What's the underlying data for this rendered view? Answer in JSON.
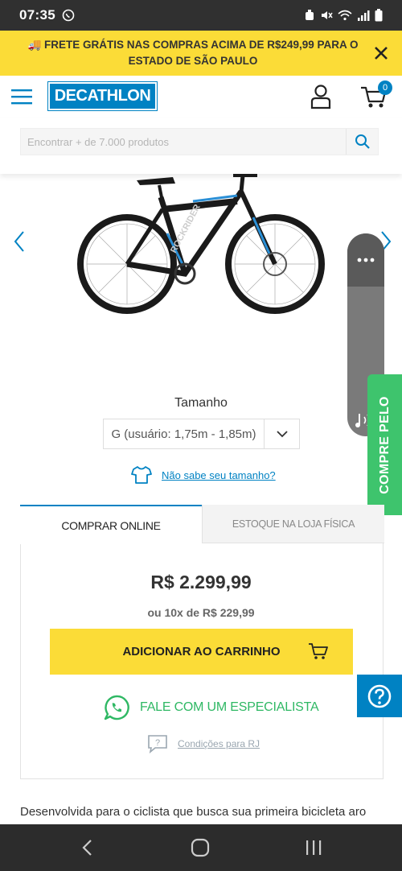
{
  "status_bar": {
    "time": "07:35"
  },
  "promo": {
    "text": "🚚 FRETE GRÁTIS NAS COMPRAS ACIMA DE R$249,99 PARA O ESTADO DE SÃO PAULO"
  },
  "header": {
    "logo": "DECATHLON",
    "cart_count": "0"
  },
  "search": {
    "placeholder": "Encontrar + de 7.000 produtos"
  },
  "product": {
    "frame_text": "ROCKRIDER"
  },
  "size": {
    "title": "Tamanho",
    "selected": "G (usuário: 1,75m - 1,85m)",
    "help_link": "Não sabe seu tamanho?"
  },
  "side_tab": {
    "label": "COMPRE PELO"
  },
  "tabs": {
    "online": "COMPRAR ONLINE",
    "store": "ESTOQUE NA LOJA FÍSICA"
  },
  "pricing": {
    "price": "R$ 2.299,99",
    "installments": "ou 10x de R$ 229,99"
  },
  "actions": {
    "add_to_cart": "ADICIONAR AO CARRINHO",
    "whatsapp": "FALE COM UM ESPECIALISTA",
    "conditions": "Condições para RJ"
  },
  "description": {
    "text": "Desenvolvida para o ciclista que busca sua primeira bicicleta aro"
  },
  "colors": {
    "brand_blue": "#0082c3",
    "promo_yellow": "#fbdc37",
    "whatsapp_green": "#2fb864"
  }
}
